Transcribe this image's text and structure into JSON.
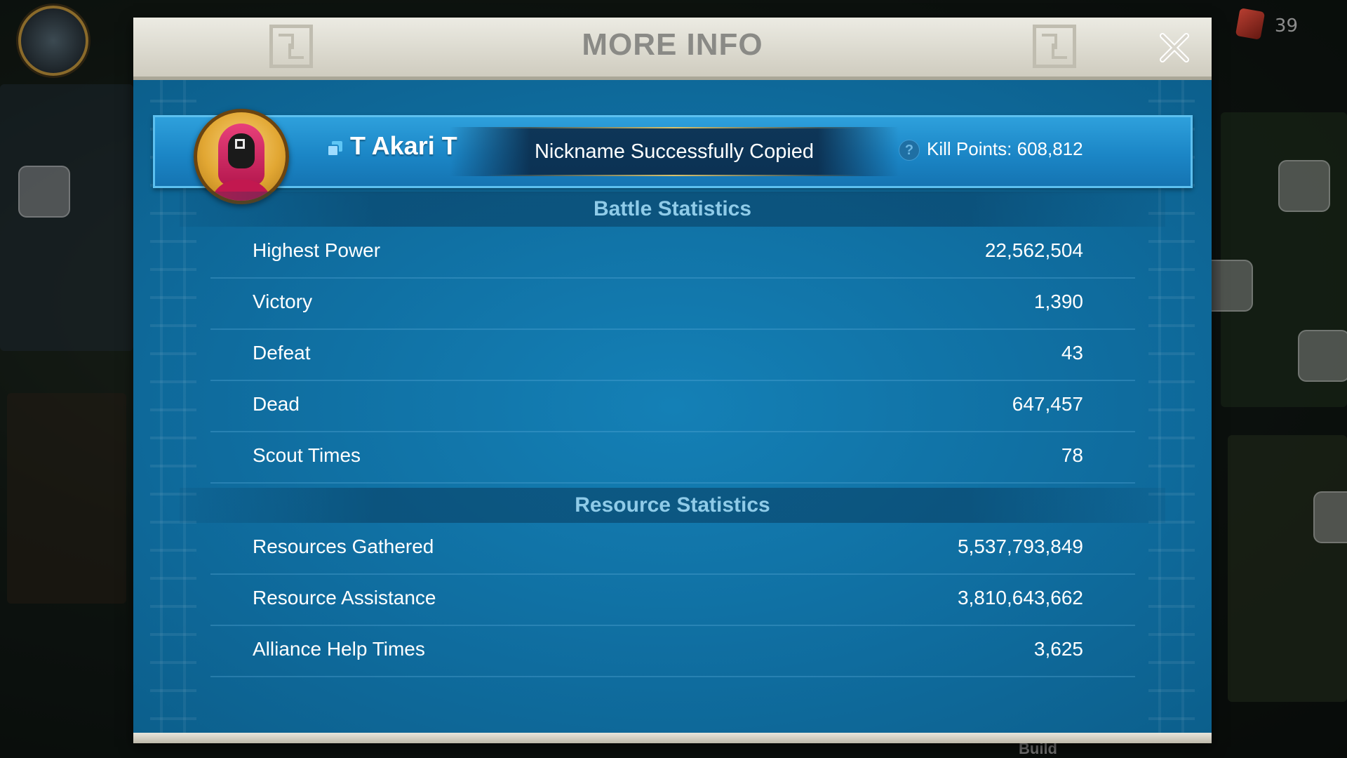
{
  "modal": {
    "title": "MORE INFO",
    "close_icon": "close-icon"
  },
  "player": {
    "name": "T Akari T",
    "copy_icon": "copy-icon",
    "toast": "Nickname Successfully Copied",
    "help_icon": "?",
    "kill_points": "Kill Points: 608,812"
  },
  "battle": {
    "title": "Battle Statistics",
    "rows": [
      {
        "label": "Highest Power",
        "value": "22,562,504"
      },
      {
        "label": "Victory",
        "value": "1,390"
      },
      {
        "label": "Defeat",
        "value": "43"
      },
      {
        "label": "Dead",
        "value": "647,457"
      },
      {
        "label": "Scout Times",
        "value": "78"
      }
    ]
  },
  "resource": {
    "title": "Resource Statistics",
    "rows": [
      {
        "label": "Resources Gathered",
        "value": "5,537,793,849"
      },
      {
        "label": "Resource Assistance",
        "value": "3,810,643,662"
      },
      {
        "label": "Alliance Help Times",
        "value": "3,625"
      }
    ]
  },
  "hud": {
    "count": "39",
    "build_label": "Build"
  },
  "colors": {
    "panel_blue": "#116ea0",
    "banner_blue": "#1b86c6",
    "header_text": "#8fcbe8",
    "title_gray": "#8a8a86"
  }
}
